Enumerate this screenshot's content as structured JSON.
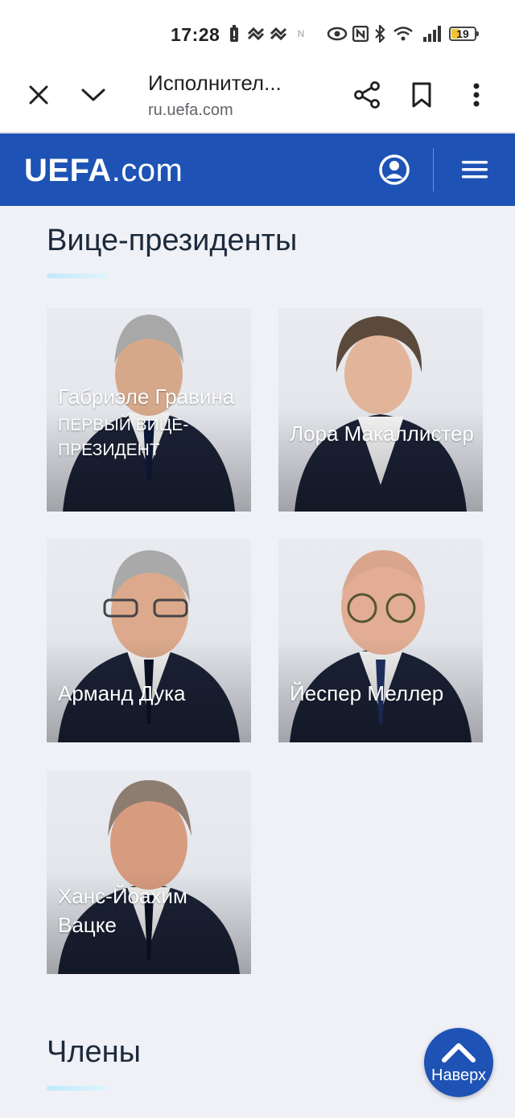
{
  "status_bar": {
    "time": "17:28",
    "battery": "19",
    "icons": [
      "battery-saver-icon",
      "vibrate-icon",
      "vibrate-icon",
      "nfc-small-icon",
      "eye-icon",
      "nfc-icon",
      "bluetooth-icon",
      "wifi-icon",
      "signal-icon"
    ]
  },
  "browser": {
    "title": "Исполнител...",
    "url": "ru.uefa.com"
  },
  "header": {
    "logo_bold": "UEFA",
    "logo_rest": ".com"
  },
  "sections": {
    "vice_presidents": "Вице-президенты",
    "members": "Члены"
  },
  "people": [
    {
      "name": "Габриэле Гравина",
      "role": "ПЕРВЫЙ ВИЦЕ-ПРЕЗИДЕНТ"
    },
    {
      "name": "Лора Макаллистер",
      "role": ""
    },
    {
      "name": "Арманд Дука",
      "role": ""
    },
    {
      "name": "Йеспер Меллер",
      "role": ""
    },
    {
      "name": "Ханс-Йоахим Вацке",
      "role": ""
    }
  ],
  "back_to_top": "Наверх",
  "colors": {
    "brand_blue": "#1e53b5",
    "page_bg": "#eff1f6",
    "accent_underline": "#bfe9fb"
  }
}
